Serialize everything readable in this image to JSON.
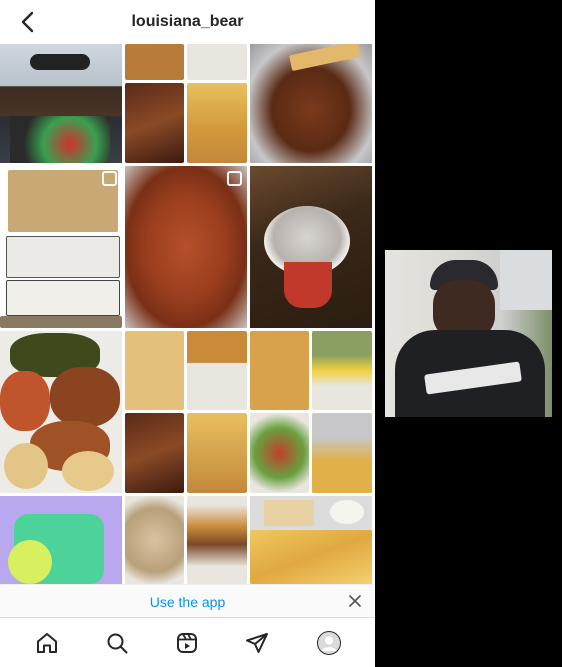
{
  "header": {
    "username": "louisiana_bear",
    "back_icon": "chevron-left-icon"
  },
  "grid": {
    "tiles": [
      {
        "name": "post-man-sunglasses",
        "type": "photo"
      },
      {
        "name": "post-ribs-fries-collage",
        "type": "collage"
      },
      {
        "name": "post-fried-wings-foil",
        "type": "photo"
      },
      {
        "name": "post-elkay-sink-boxes",
        "type": "carousel"
      },
      {
        "name": "post-seasoned-chicken-tray",
        "type": "carousel"
      },
      {
        "name": "post-sauce-cup",
        "type": "photo"
      },
      {
        "name": "post-chicken-greens-spaghetti",
        "type": "photo"
      },
      {
        "name": "post-fish-burger-collage",
        "type": "collage"
      },
      {
        "name": "post-fried-fish-wings-collage",
        "type": "collage"
      },
      {
        "name": "post-colorful-app-graphic",
        "type": "photo"
      },
      {
        "name": "post-chicken-salad-burger-collage",
        "type": "collage"
      },
      {
        "name": "post-fries-bread-plate",
        "type": "photo"
      }
    ]
  },
  "banner": {
    "use_app_label": "Use the app",
    "close_icon": "close-icon"
  },
  "bottom_nav": {
    "items": [
      "home-icon",
      "search-icon",
      "reels-icon",
      "direct-send-icon",
      "profile-avatar"
    ]
  },
  "side_photo": {
    "name": "man-cowboys-hoodie-photo"
  },
  "colors": {
    "link_blue": "#0095f6",
    "text_dark": "#262626",
    "page_bg": "#000000"
  }
}
